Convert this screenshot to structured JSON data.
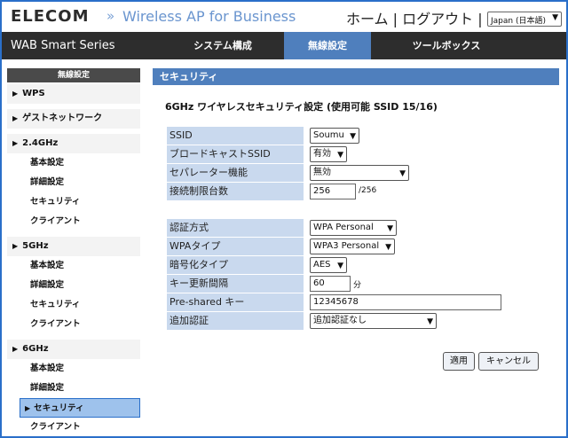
{
  "header": {
    "logo": "ELECOM",
    "chevron": "»",
    "product": "Wireless AP for Business",
    "links": [
      "ホーム",
      "|",
      "ログアウト",
      "|"
    ],
    "language": "Japan (日本語)"
  },
  "nav": {
    "series": "WAB Smart Series",
    "tabs": [
      {
        "label": "システム構成",
        "active": false
      },
      {
        "label": "無線設定",
        "active": true
      },
      {
        "label": "ツールボックス",
        "active": false
      }
    ]
  },
  "sidebar": {
    "heading": "無線設定",
    "groups": [
      {
        "label": "WPS",
        "subs": []
      },
      {
        "label": "ゲストネットワーク",
        "subs": []
      },
      {
        "label": "2.4GHz",
        "subs": [
          "基本設定",
          "詳細設定",
          "セキュリティ",
          "クライアント"
        ]
      },
      {
        "label": "5GHz",
        "subs": [
          "基本設定",
          "詳細設定",
          "セキュリティ",
          "クライアント"
        ]
      },
      {
        "label": "6GHz",
        "subs": [
          "基本設定",
          "詳細設定",
          "セキュリティ",
          "クライアント"
        ]
      }
    ],
    "active_item": "6GHz / セキュリティ"
  },
  "main": {
    "panel_title": "セキュリティ",
    "section_title": "6GHz ワイヤレスセキュリティ設定 (使用可能 SSID 15/16)",
    "fields": {
      "ssid": {
        "label": "SSID",
        "value": "Soumu"
      },
      "broadcast": {
        "label": "ブロードキャストSSID",
        "value": "有効"
      },
      "separator": {
        "label": "セパレーター機能",
        "value": "無効"
      },
      "max_clients": {
        "label": "接続制限台数",
        "value": "256",
        "suffix": "/256"
      },
      "auth": {
        "label": "認証方式",
        "value": "WPA Personal"
      },
      "wpa_type": {
        "label": "WPAタイプ",
        "value": "WPA3 Personal"
      },
      "encryption": {
        "label": "暗号化タイプ",
        "value": "AES"
      },
      "key_interval": {
        "label": "キー更新間隔",
        "value": "60",
        "suffix": "分"
      },
      "psk": {
        "label": "Pre-shared キー",
        "value": "12345678"
      },
      "extra_auth": {
        "label": "追加認証",
        "value": "追加認証なし"
      }
    },
    "buttons": {
      "apply": "適用",
      "cancel": "キャンセル"
    }
  },
  "icons": {
    "dropdown": "chevron-down-icon",
    "expand": "triangle-right-icon"
  },
  "colors": {
    "accent": "#4f7fbd",
    "label_bg": "#c9d9ee",
    "nav_bg": "#2d2d2d",
    "frame": "#2a6fc9"
  }
}
